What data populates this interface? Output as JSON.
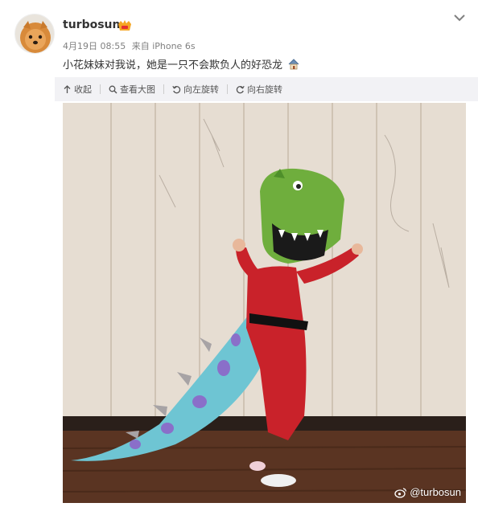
{
  "user": {
    "name": "turbosun",
    "avatar_icon": "pomeranian-avatar"
  },
  "meta": {
    "date": "4月19日 08:55",
    "source": "来自 iPhone 6s"
  },
  "post": {
    "text": "小花妹妹对我说，她是一只不会欺负人的好恐龙"
  },
  "toolbar": {
    "collapse_label": "收起",
    "view_large_label": "查看大图",
    "rotate_left_label": "向左旋转",
    "rotate_right_label": "向右旋转"
  },
  "image": {
    "watermark": "@turbosun"
  },
  "colors": {
    "toolbar_bg": "#f2f2f5",
    "text": "#333333",
    "meta": "#808080"
  }
}
